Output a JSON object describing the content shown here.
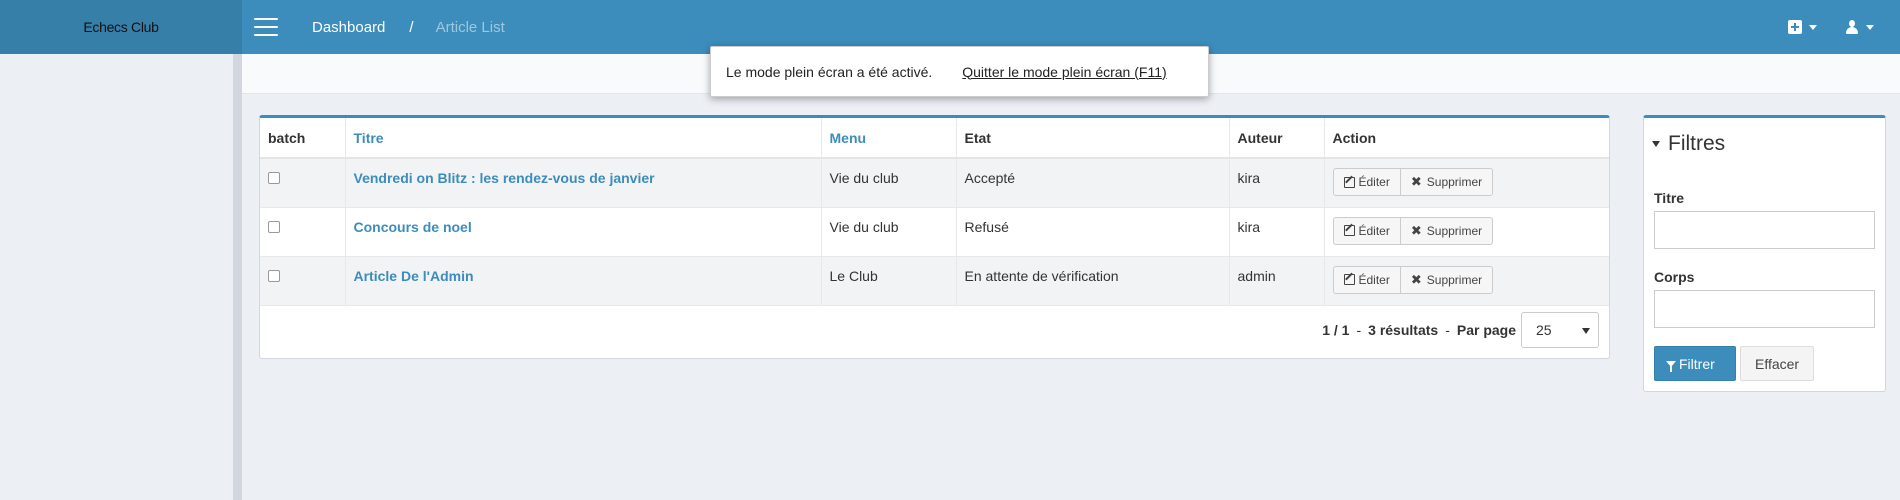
{
  "app": {
    "logo_text": "Echecs Club"
  },
  "breadcrumb": {
    "home": "Dashboard",
    "separator": "/",
    "current": "Article List"
  },
  "fullscreen_notice": {
    "message": "Le mode plein écran a été activé.",
    "exit_link": "Quitter le mode plein écran (F11)"
  },
  "table": {
    "headers": {
      "batch": "batch",
      "titre": "Titre",
      "menu": "Menu",
      "etat": "Etat",
      "auteur": "Auteur",
      "action": "Action"
    },
    "rows": [
      {
        "titre": "Vendredi on Blitz : les rendez-vous de janvier",
        "menu": "Vie du club",
        "etat": "Accepté",
        "auteur": "kira"
      },
      {
        "titre": "Concours de noel",
        "menu": "Vie du club",
        "etat": "Refusé",
        "auteur": "kira"
      },
      {
        "titre": "Article De l'Admin",
        "menu": "Le Club",
        "etat": "En attente de vérification",
        "auteur": "admin"
      }
    ],
    "actions": {
      "edit": "Éditer",
      "delete": "Supprimer"
    },
    "pagination": {
      "pages": "1 / 1",
      "dash": "-",
      "results": "3 résultats",
      "per_page_label": "Par page",
      "per_page_value": "25"
    }
  },
  "filters": {
    "title": "Filtres",
    "fields": [
      {
        "label": "Titre",
        "value": ""
      },
      {
        "label": "Corps",
        "value": ""
      }
    ],
    "submit": "Filtrer",
    "clear": "Effacer"
  },
  "colors": {
    "primary": "#3c8dbc",
    "primary_dark": "#367fa9",
    "background": "#ecf0f5"
  }
}
